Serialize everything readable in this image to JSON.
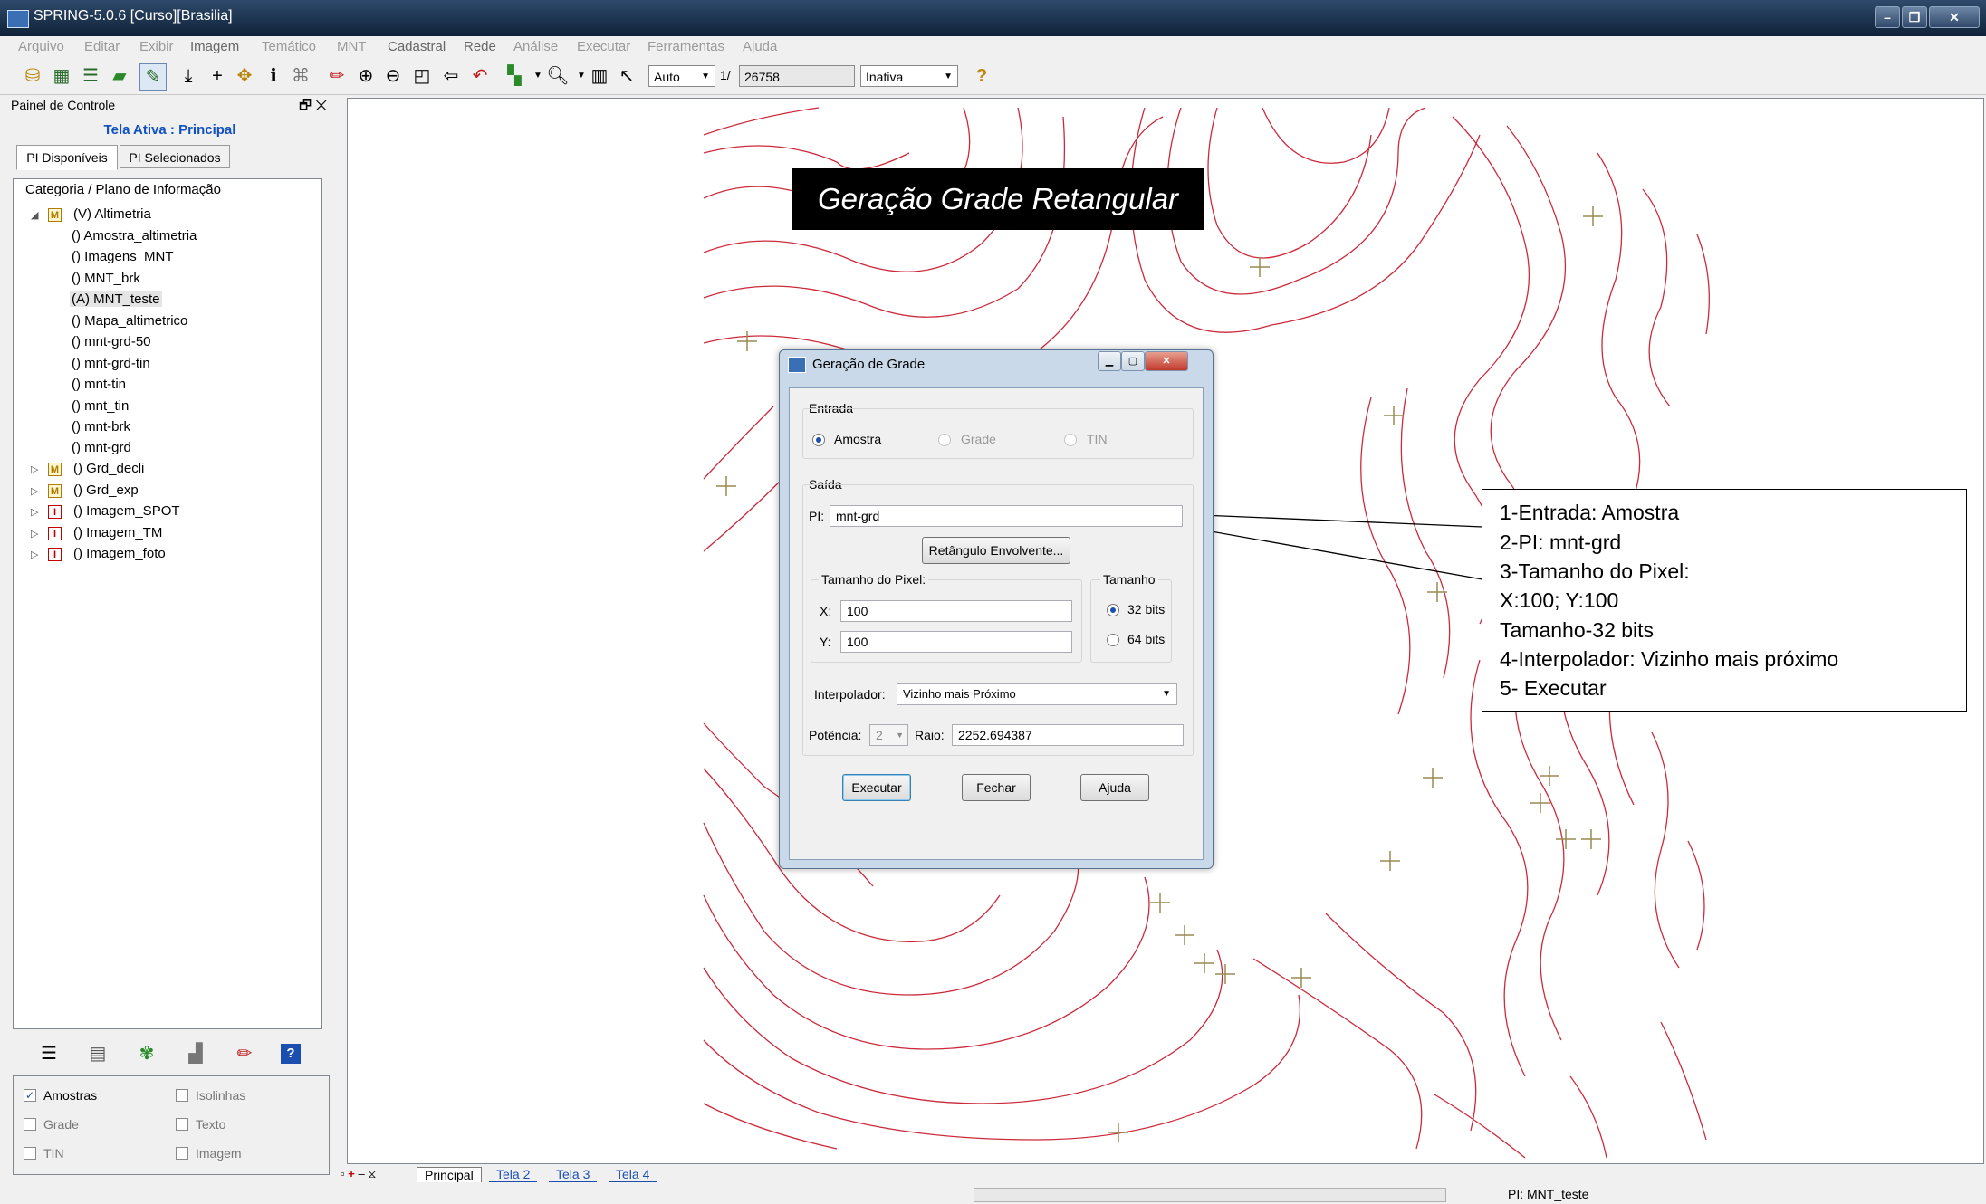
{
  "window": {
    "title": "SPRING-5.0.6 [Curso][Brasilia]"
  },
  "menubar": {
    "items": [
      "Arquivo",
      "Editar",
      "Exibir",
      "Imagem",
      "Temático",
      "MNT",
      "Cadastral",
      "Rede",
      "Análise",
      "Executar",
      "Ferramentas",
      "Ajuda"
    ]
  },
  "toolbar": {
    "scale_mode": "Auto",
    "scale_prefix": "1/",
    "scale_value": "26758",
    "status_select": "Inativa",
    "help_glyph": "?"
  },
  "panel": {
    "title": "Painel de Controle",
    "active_screen": "Tela Ativa : Principal",
    "tabs": [
      "PI Disponíveis",
      "PI Selecionados"
    ],
    "tree_header": "Categoria / Plano de Informação",
    "tree": [
      {
        "label": "(V) Altimetria",
        "type": "M"
      },
      {
        "label": "() Amostra_altimetria"
      },
      {
        "label": "() Imagens_MNT"
      },
      {
        "label": "() MNT_brk"
      },
      {
        "label": "(A) MNT_teste"
      },
      {
        "label": "() Mapa_altimetrico"
      },
      {
        "label": "() mnt-grd-50"
      },
      {
        "label": "() mnt-grd-tin"
      },
      {
        "label": "() mnt-tin"
      },
      {
        "label": "() mnt_tin"
      },
      {
        "label": "() mnt-brk"
      },
      {
        "label": "() mnt-grd"
      },
      {
        "label": "() Grd_decli",
        "type": "M"
      },
      {
        "label": "() Grd_exp",
        "type": "M"
      },
      {
        "label": "() Imagem_SPOT",
        "type": "I"
      },
      {
        "label": "() Imagem_TM",
        "type": "I"
      },
      {
        "label": "() Imagem_foto",
        "type": "I"
      }
    ],
    "checks": [
      {
        "label": "Amostras",
        "checked": true
      },
      {
        "label": "Isolinhas",
        "checked": false
      },
      {
        "label": "Grade",
        "checked": false
      },
      {
        "label": "Texto",
        "checked": false
      },
      {
        "label": "TIN",
        "checked": false
      },
      {
        "label": "Imagem",
        "checked": false
      }
    ]
  },
  "banner": {
    "text": "Geração Grade Retangular"
  },
  "dialog": {
    "title": "Geração de Grade",
    "entrada_label": "Entrada",
    "entrada_options": [
      "Amostra",
      "Grade",
      "TIN"
    ],
    "saida_label": "Saída",
    "pi_label": "PI:",
    "pi_value": "mnt-grd",
    "retangulo_button": "Retângulo Envolvente...",
    "pixel_group": "Tamanho do Pixel:",
    "x_label": "X:",
    "x_value": "100",
    "y_label": "Y:",
    "y_value": "100",
    "tamanho_group": "Tamanho",
    "bits_options": [
      "32 bits",
      "64 bits"
    ],
    "interpolador_label": "Interpolador:",
    "interpolador_value": "Vizinho mais Próximo",
    "potencia_label": "Potência:",
    "potencia_value": "2",
    "raio_label": "Raio:",
    "raio_value": "2252.694387",
    "buttons": {
      "execute": "Executar",
      "close": "Fechar",
      "help": "Ajuda"
    }
  },
  "callout": {
    "lines": [
      "1-Entrada: Amostra",
      "2-PI: mnt-grd",
      "3-Tamanho do Pixel:",
      "X:100; Y:100",
      "Tamanho-32 bits",
      "4-Interpolador: Vizinho mais próximo",
      "5- Executar"
    ]
  },
  "screen_tabs": [
    "Principal",
    "Tela 2",
    "Tela 3",
    "Tela 4"
  ],
  "status": {
    "pi": "PI: MNT_teste"
  },
  "colors": {
    "contour": "#cc2a3a",
    "sample_marker": "#9a8a50",
    "active_screen_text": "#1050c0"
  }
}
